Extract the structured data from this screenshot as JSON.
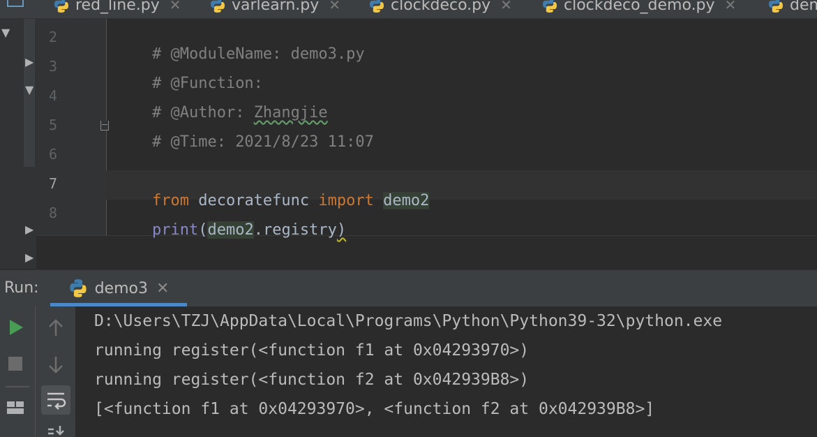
{
  "tabs": [
    {
      "label": "red_line.py"
    },
    {
      "label": "varlearn.py"
    },
    {
      "label": "clockdeco.py"
    },
    {
      "label": "clockdeco_demo.py"
    },
    {
      "label": "dem"
    }
  ],
  "editor": {
    "lines": [
      {
        "num": "2",
        "text": "# @ModuleName: demo3.py"
      },
      {
        "num": "3",
        "text": "# @Function:"
      },
      {
        "num": "4",
        "prefix": "# @Author: ",
        "author": "Zhangjie"
      },
      {
        "num": "5",
        "text": "# @Time: 2021/8/23 11:07"
      },
      {
        "num": "6",
        "text": ""
      },
      {
        "num": "7",
        "kw_from": "from",
        "module": " decoratefunc ",
        "kw_import": "import",
        "name": "demo2"
      },
      {
        "num": "8",
        "builtin": "print",
        "open": "(",
        "arg": "demo2",
        "attr": ".registry",
        "close": ")"
      }
    ]
  },
  "run": {
    "label": "Run:",
    "tab_label": "demo3",
    "output": [
      "D:\\Users\\TZJ\\AppData\\Local\\Programs\\Python\\Python39-32\\python.exe",
      "running register(<function f1 at 0x04293970>)",
      "running register(<function f2 at 0x042939B8>)",
      "[<function f1 at 0x04293970>, <function f2 at 0x042939B8>]"
    ]
  },
  "colors": {
    "accent": "#4a88c7",
    "run_green": "#499c54",
    "keyword": "#cc7832",
    "comment": "#808080"
  }
}
